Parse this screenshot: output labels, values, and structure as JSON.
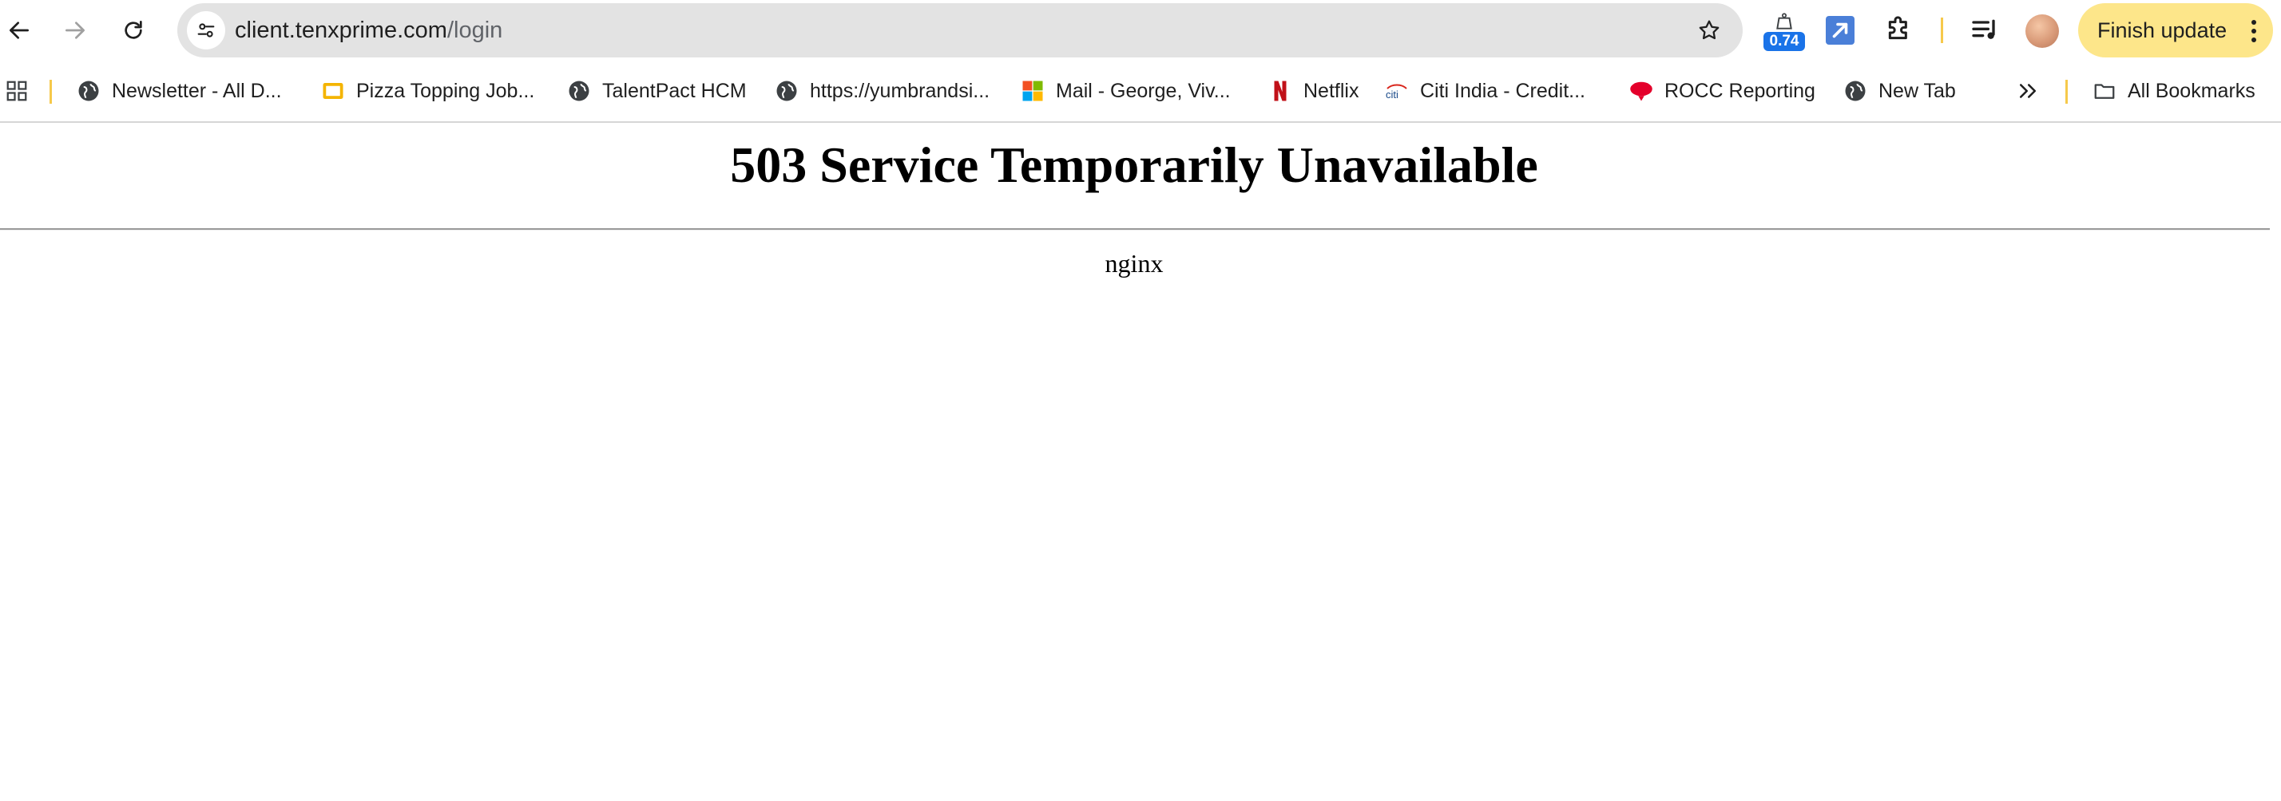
{
  "browser": {
    "url_host": "client.tenxprime.com",
    "url_path": "/login",
    "extension_badge": "0.74",
    "finish_update_label": "Finish update"
  },
  "bookmarks": {
    "items": [
      {
        "label": "Newsletter - All D...",
        "icon": "globe-icon"
      },
      {
        "label": "Pizza Topping Job...",
        "icon": "slides-icon"
      },
      {
        "label": "TalentPact HCM",
        "icon": "globe-icon"
      },
      {
        "label": "https://yumbrandsi...",
        "icon": "globe-icon"
      },
      {
        "label": "Mail - George, Viv...",
        "icon": "microsoft-icon"
      },
      {
        "label": "Netflix",
        "icon": "netflix-icon"
      },
      {
        "label": "Citi India - Credit...",
        "icon": "citi-icon"
      },
      {
        "label": "ROCC Reporting",
        "icon": "yum-icon"
      },
      {
        "label": "New Tab",
        "icon": "globe-icon"
      }
    ],
    "all_bookmarks_label": "All Bookmarks"
  },
  "page": {
    "title": "503 Service Temporarily Unavailable",
    "server": "nginx"
  },
  "colors": {
    "omnibox_bg": "#e3e3e3",
    "finish_update_bg": "#fde68a",
    "badge_blue": "#1a73e8",
    "separator_yellow": "#f6c94b"
  }
}
